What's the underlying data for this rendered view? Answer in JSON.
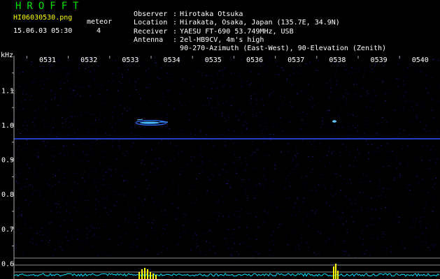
{
  "header": {
    "brand": "HROFFT",
    "filename": "HI06030530.png",
    "datetime": "15.06.03 05:30",
    "meteor_label": "meteor",
    "meteor_count": "4"
  },
  "metadata": [
    {
      "key": "Observer",
      "value": "Hirotaka Otsuka"
    },
    {
      "key": "Location",
      "value": "Hirakata, Osaka, Japan (135.7E, 34.9N)"
    },
    {
      "key": "Receiver",
      "value": "YAESU FT-690 53.749MHz, USB"
    },
    {
      "key": "Antenna",
      "value": "2el-HB9CV, 4m's high"
    },
    {
      "key": "",
      "value": "90-270-Azimuth (East-West), 90-Elevation (Zenith)"
    }
  ],
  "axis": {
    "y_unit": "kHz",
    "time_ticks": [
      "0531",
      "0532",
      "0533",
      "0534",
      "0535",
      "0536",
      "0537",
      "0538",
      "0539",
      "0540"
    ],
    "freq_ticks": [
      "1.1",
      "1.0",
      "0.9",
      "0.8",
      "0.7",
      "0.6"
    ]
  },
  "colors": {
    "background": "#000000",
    "text": "#ffffff",
    "brand": "#00e000",
    "filename": "#ffff00",
    "noise": "#1a1aa0",
    "carrier": "#3050ff",
    "echo": "#3fa8ff",
    "amplitude": "#00e0ff",
    "amplitude_peak": "#ffff00",
    "grid": "#8a8a8a"
  },
  "chart_data": {
    "type": "heatmap",
    "y_unit": "kHz",
    "ylim": [
      0.56,
      1.17
    ],
    "xlim": [
      "05:30",
      "05:40"
    ],
    "carrier_khz": 0.96,
    "echoes": [
      {
        "time": "05:33.4",
        "freq_khz": 1.0,
        "strength": "strong"
      },
      {
        "time": "05:37.8",
        "freq_khz": 1.01,
        "strength": "weak"
      }
    ]
  }
}
